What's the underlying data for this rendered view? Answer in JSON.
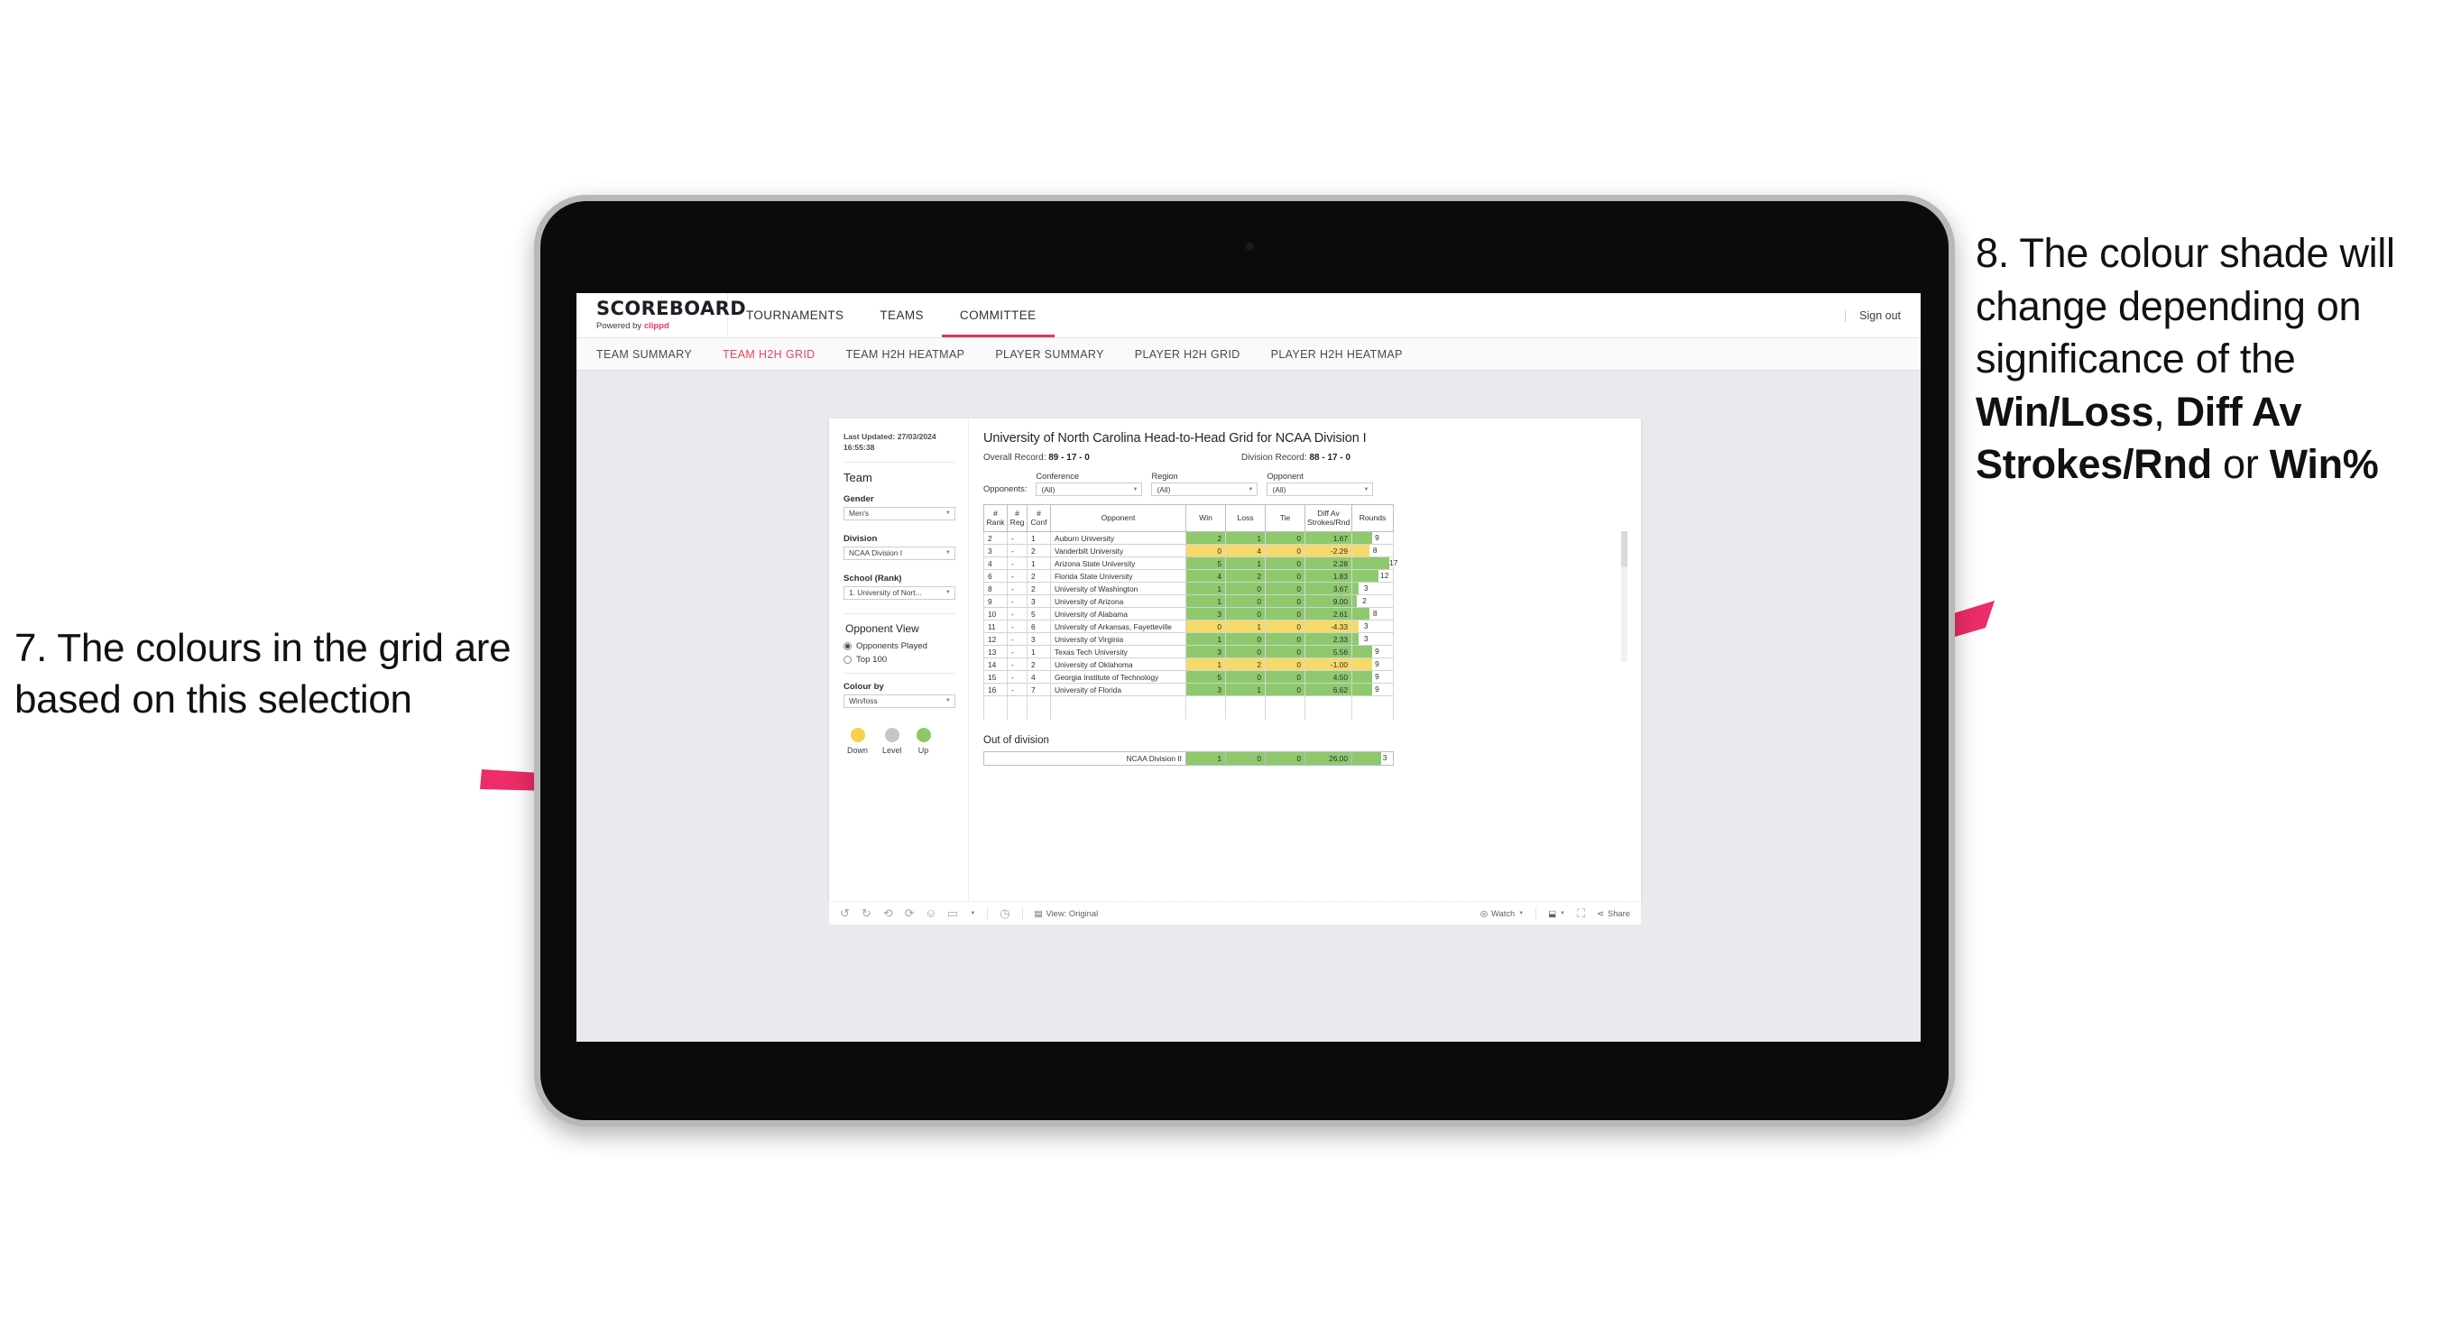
{
  "annotations": {
    "left": {
      "number": "7.",
      "text": "The colours in the grid are based on this selection"
    },
    "right": {
      "number": "8.",
      "line1": "The colour shade will change depending on significance of the ",
      "bold1": "Win/Loss",
      "mid1": ", ",
      "bold2": "Diff Av Strokes/Rnd",
      "mid2": " or ",
      "bold3": "Win%"
    }
  },
  "app": {
    "logo_main": "SCOREBOARD",
    "logo_sub_prefix": "Powered by ",
    "logo_brand": "clippd",
    "top_nav": [
      {
        "label": "TOURNAMENTS",
        "active": false
      },
      {
        "label": "TEAMS",
        "active": false
      },
      {
        "label": "COMMITTEE",
        "active": true
      }
    ],
    "sign_out": "Sign out",
    "divider": "|",
    "sub_nav": [
      {
        "label": "TEAM SUMMARY",
        "active": false
      },
      {
        "label": "TEAM H2H GRID",
        "active": true
      },
      {
        "label": "TEAM H2H HEATMAP",
        "active": false
      },
      {
        "label": "PLAYER SUMMARY",
        "active": false
      },
      {
        "label": "PLAYER H2H GRID",
        "active": false
      },
      {
        "label": "PLAYER H2H HEATMAP",
        "active": false
      }
    ]
  },
  "sidebar": {
    "last_updated_label": "Last Updated:",
    "last_updated_date": "27/03/2024",
    "last_updated_time": "16:55:38",
    "team_heading": "Team",
    "gender_label": "Gender",
    "gender_value": "Men's",
    "division_label": "Division",
    "division_value": "NCAA Division I",
    "school_label": "School (Rank)",
    "school_value": "1. University of Nort...",
    "opponent_view_heading": "Opponent View",
    "opponent_view_options": [
      {
        "label": "Opponents Played",
        "selected": true
      },
      {
        "label": "Top 100",
        "selected": false
      }
    ],
    "colour_by_label": "Colour by",
    "colour_by_value": "Win/loss",
    "legend": [
      {
        "label": "Down",
        "color": "#f5d14e"
      },
      {
        "label": "Level",
        "color": "#c3c7cb"
      },
      {
        "label": "Up",
        "color": "#8cc863"
      }
    ]
  },
  "viz": {
    "title": "University of North Carolina Head-to-Head Grid for NCAA Division I",
    "overall_record_label": "Overall Record:",
    "overall_record_value": "89 - 17 - 0",
    "division_record_label": "Division Record:",
    "division_record_value": "88 - 17 - 0",
    "opponents_label": "Opponents:",
    "filters": [
      {
        "label": "Conference",
        "value": "(All)"
      },
      {
        "label": "Region",
        "value": "(All)"
      },
      {
        "label": "Opponent",
        "value": "(All)"
      }
    ],
    "out_of_division_heading": "Out of division"
  },
  "chart_data": {
    "type": "table",
    "title": "University of North Carolina Head-to-Head Grid for NCAA Division I",
    "columns": [
      "# Rank",
      "# Reg",
      "# Conf",
      "Opponent",
      "Win",
      "Loss",
      "Tie",
      "Diff Av Strokes/Rnd",
      "Rounds"
    ],
    "column_headers_multiline": [
      [
        "#",
        "Rank"
      ],
      [
        "#",
        "Reg"
      ],
      [
        "#",
        "Conf"
      ],
      [
        "Opponent"
      ],
      [
        "Win"
      ],
      [
        "Loss"
      ],
      [
        "Tie"
      ],
      [
        "Diff Av",
        "Strokes/Rnd"
      ],
      [
        "Rounds"
      ]
    ],
    "rounds_max": 17,
    "rows": [
      {
        "rank": "2",
        "reg": "-",
        "conf": "1",
        "opponent": "Auburn University",
        "win": "2",
        "loss": "1",
        "tie": "0",
        "diff": "1.67",
        "rounds": "9",
        "state": "up"
      },
      {
        "rank": "3",
        "reg": "-",
        "conf": "2",
        "opponent": "Vanderbilt University",
        "win": "0",
        "loss": "4",
        "tie": "0",
        "diff": "-2.29",
        "rounds": "8",
        "state": "down"
      },
      {
        "rank": "4",
        "reg": "-",
        "conf": "1",
        "opponent": "Arizona State University",
        "win": "5",
        "loss": "1",
        "tie": "0",
        "diff": "2.28",
        "rounds": "17",
        "state": "up"
      },
      {
        "rank": "6",
        "reg": "-",
        "conf": "2",
        "opponent": "Florida State University",
        "win": "4",
        "loss": "2",
        "tie": "0",
        "diff": "1.83",
        "rounds": "12",
        "state": "up"
      },
      {
        "rank": "8",
        "reg": "-",
        "conf": "2",
        "opponent": "University of Washington",
        "win": "1",
        "loss": "0",
        "tie": "0",
        "diff": "3.67",
        "rounds": "3",
        "state": "up"
      },
      {
        "rank": "9",
        "reg": "-",
        "conf": "3",
        "opponent": "University of Arizona",
        "win": "1",
        "loss": "0",
        "tie": "0",
        "diff": "9.00",
        "rounds": "2",
        "state": "up"
      },
      {
        "rank": "10",
        "reg": "-",
        "conf": "5",
        "opponent": "University of Alabama",
        "win": "3",
        "loss": "0",
        "tie": "0",
        "diff": "2.61",
        "rounds": "8",
        "state": "up"
      },
      {
        "rank": "11",
        "reg": "-",
        "conf": "6",
        "opponent": "University of Arkansas, Fayetteville",
        "win": "0",
        "loss": "1",
        "tie": "0",
        "diff": "-4.33",
        "rounds": "3",
        "state": "down"
      },
      {
        "rank": "12",
        "reg": "-",
        "conf": "3",
        "opponent": "University of Virginia",
        "win": "1",
        "loss": "0",
        "tie": "0",
        "diff": "2.33",
        "rounds": "3",
        "state": "up"
      },
      {
        "rank": "13",
        "reg": "-",
        "conf": "1",
        "opponent": "Texas Tech University",
        "win": "3",
        "loss": "0",
        "tie": "0",
        "diff": "5.56",
        "rounds": "9",
        "state": "up"
      },
      {
        "rank": "14",
        "reg": "-",
        "conf": "2",
        "opponent": "University of Oklahoma",
        "win": "1",
        "loss": "2",
        "tie": "0",
        "diff": "-1.00",
        "rounds": "9",
        "state": "down"
      },
      {
        "rank": "15",
        "reg": "-",
        "conf": "4",
        "opponent": "Georgia Institute of Technology",
        "win": "5",
        "loss": "0",
        "tie": "0",
        "diff": "4.50",
        "rounds": "9",
        "state": "up"
      },
      {
        "rank": "16",
        "reg": "-",
        "conf": "7",
        "opponent": "University of Florida",
        "win": "3",
        "loss": "1",
        "tie": "0",
        "diff": "6.62",
        "rounds": "9",
        "state": "up"
      }
    ],
    "out_of_division": {
      "label": "NCAA Division II",
      "win": "1",
      "loss": "0",
      "tie": "0",
      "diff": "26.00",
      "rounds": "3",
      "state": "up"
    }
  },
  "toolbar": {
    "undo_icon": "undo-icon",
    "redo_icon": "redo-icon",
    "revert_icon": "revert-icon",
    "refresh_icon": "refresh-icon",
    "pause_icon": "pause-icon",
    "alerts_icon": "alerts-icon",
    "view_label": "View: Original",
    "watch_label": "Watch",
    "share_label": "Share"
  }
}
